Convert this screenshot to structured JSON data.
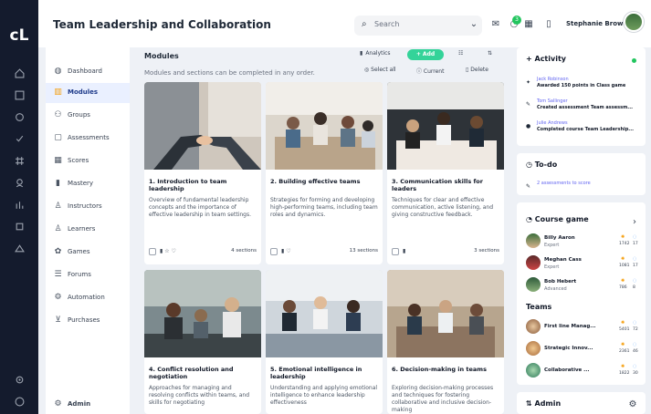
{
  "app": {
    "title": "Team Leadership and Collaboration",
    "logo_text": "cL"
  },
  "header": {
    "search_label": "Search",
    "notification_count": "3",
    "user_name": "Stephanie Brown"
  },
  "nav": {
    "items": [
      {
        "label": "Dashboard",
        "icon": "dashboard-icon"
      },
      {
        "label": "Modules",
        "icon": "modules-icon"
      },
      {
        "label": "Groups",
        "icon": "groups-icon"
      },
      {
        "label": "Assessments",
        "icon": "assessments-icon"
      },
      {
        "label": "Scores",
        "icon": "scores-icon"
      },
      {
        "label": "Mastery",
        "icon": "mastery-icon"
      },
      {
        "label": "Instructors",
        "icon": "instructors-icon"
      },
      {
        "label": "Learners",
        "icon": "learners-icon"
      },
      {
        "label": "Games",
        "icon": "games-icon"
      },
      {
        "label": "Forums",
        "icon": "forums-icon"
      },
      {
        "label": "Automation",
        "icon": "automation-icon"
      },
      {
        "label": "Purchases",
        "icon": "purchases-icon"
      }
    ],
    "admin_label": "Admin"
  },
  "main": {
    "title": "Modules",
    "subtitle": "Modules and sections can be completed in any order.",
    "analytics_label": "Analytics",
    "add_label": "+ Add",
    "select_all_label": "Select all",
    "current_label": "Current",
    "delete_label": "Delete",
    "cards": [
      {
        "title": "1. Introduction to team leadership",
        "desc": "Overview of fundamental leadership concepts and the importance of effective leadership in team settings.",
        "sections": "4 sections"
      },
      {
        "title": "2. Building effective teams",
        "desc": "Strategies for forming and developing high-performing teams, including team roles and dynamics.",
        "sections": "13 sections"
      },
      {
        "title": "3. Communication skills for leaders",
        "desc": "Techniques for clear and effective communication, active listening, and giving constructive feedback.",
        "sections": "3 sections"
      },
      {
        "title": "4. Conflict resolution and negotiation",
        "desc": "Approaches for managing and resolving conflicts within teams, and skills for negotiating",
        "sections": ""
      },
      {
        "title": "5. Emotional intelligence in leadership",
        "desc": "Understanding and applying emotional intelligence to enhance leadership effectiveness",
        "sections": ""
      },
      {
        "title": "6. Decision-making in teams",
        "desc": "Exploring decision-making processes and techniques for fostering collaborative and inclusive decision-making",
        "sections": ""
      }
    ]
  },
  "activity": {
    "title": "Activity",
    "items": [
      {
        "who": "Jack Robinson",
        "what": "Awarded 150 points in Class game"
      },
      {
        "who": "Tom Sallinger",
        "what": "Created assessment Team assessm..."
      },
      {
        "who": "Julie Andrews",
        "what": "Completed course Team Leadership..."
      }
    ]
  },
  "todo": {
    "title": "To-do",
    "item": "2 assessments to score"
  },
  "course_game": {
    "title": "Course game",
    "players": [
      {
        "name": "Billy Aaron",
        "level": "Expert",
        "v1": "1742",
        "v2": "17"
      },
      {
        "name": "Meghan Cass",
        "level": "Expert",
        "v1": "1081",
        "v2": "17"
      },
      {
        "name": "Bob Hebert",
        "level": "Advanced",
        "v1": "786",
        "v2": "8"
      }
    ],
    "teams_title": "Teams",
    "teams": [
      {
        "name": "First line Manag...",
        "v1": "5401",
        "v2": "72"
      },
      {
        "name": "Strategic Innov...",
        "v1": "2361",
        "v2": "46"
      },
      {
        "name": "Collaborative ...",
        "v1": "1822",
        "v2": "30"
      }
    ]
  },
  "admin_panel": {
    "title": "Admin"
  },
  "colors": {
    "rail": "#141b2d",
    "accent_green": "#34d399",
    "active_bg": "#eaf0ff"
  }
}
